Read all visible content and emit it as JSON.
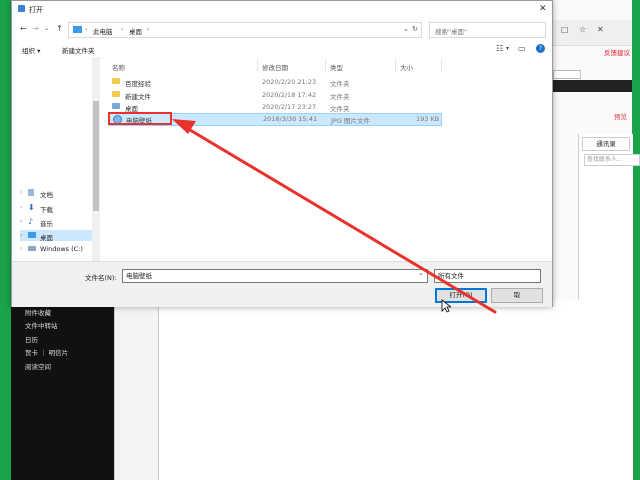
{
  "dialog": {
    "title": "打开",
    "breadcrumb": {
      "root": "此电脑",
      "current": "桌面"
    },
    "search_placeholder": "搜索\"桌面\"",
    "toolbar": {
      "organize": "组织 ▾",
      "new_folder": "新建文件夹"
    },
    "columns": {
      "name": "名称",
      "date": "修改日期",
      "type": "类型",
      "size": "大小"
    },
    "files": [
      {
        "name": "百度经验",
        "date": "2020/2/20 21:23",
        "type": "文件夹",
        "size": "",
        "kind": "folder",
        "selected": false
      },
      {
        "name": "新建文件",
        "date": "2020/2/18 17:42",
        "type": "文件夹",
        "size": "",
        "kind": "folder",
        "selected": false
      },
      {
        "name": "桌面",
        "date": "2020/2/17 23:27",
        "type": "文件夹",
        "size": "",
        "kind": "folder",
        "selected": false
      },
      {
        "name": "电脑壁纸",
        "date": "2018/3/30 15:41",
        "type": "JPG 图片文件",
        "size": "193 KB",
        "kind": "jpg",
        "selected": true
      }
    ],
    "nav_items": [
      {
        "label": "文档",
        "icon": "document-icon",
        "selected": false
      },
      {
        "label": "下载",
        "icon": "download-icon",
        "selected": false
      },
      {
        "label": "音乐",
        "icon": "music-icon",
        "selected": false
      },
      {
        "label": "桌面",
        "icon": "desktop-icon",
        "selected": true
      },
      {
        "label": "Windows (C:)",
        "icon": "drive-icon",
        "selected": false
      }
    ],
    "filename_label": "文件名(N):",
    "filename_value": "电脑壁纸",
    "filetype_value": "所有文件",
    "open_button": "打开(O)",
    "cancel_button": "取"
  },
  "background": {
    "feedback_link": "反馈建议",
    "contacts_tab": "通讯录",
    "contacts_search_placeholder": "查找联系人...",
    "side_text": "预览",
    "sidebar_items": [
      "附件收藏",
      "文件中转站",
      "日历",
      "贺卡 ｜ 明信片",
      "阅读空间"
    ]
  },
  "colors": {
    "arrow": "#e8322b",
    "highlight": "#e8322b",
    "selection": "#cce8ff",
    "green_frame": "#1aa34a"
  }
}
